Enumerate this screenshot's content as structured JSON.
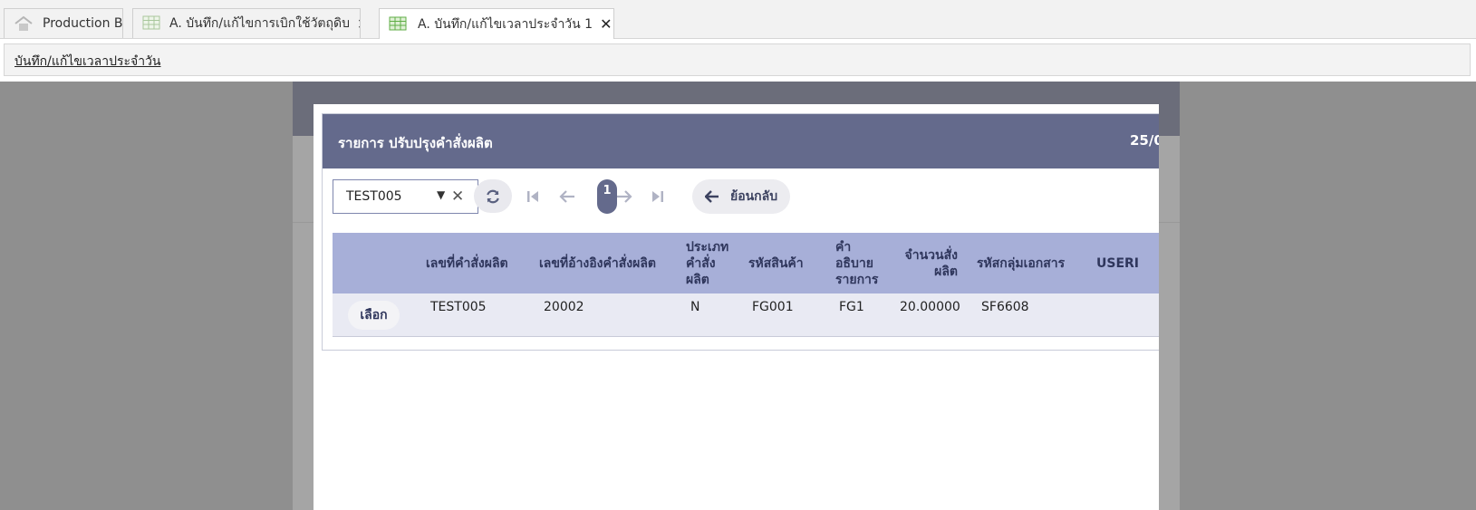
{
  "tabs": [
    {
      "label": "Production BI",
      "icon": "home-icon",
      "closable": false
    },
    {
      "label": "A. บันทึก/แก้ไขการเบิกใช้วัตถุดิบ",
      "icon": "table-icon",
      "closable": true
    },
    {
      "label": "A. บันทึก/แก้ไขเวลาประจำวัน 1",
      "icon": "table-icon",
      "closable": true,
      "active": true
    }
  ],
  "tab_close_glyph": "✕",
  "breadcrumb": "บันทึก/แก้ไขเวลาประจำวัน",
  "modal": {
    "title": "รายการ ปรับปรุงคำสั่งผลิต",
    "date_partial": "25/0",
    "filter": {
      "value": "TEST005"
    },
    "pagination": {
      "current_page": "1"
    },
    "back_label": "ย้อนกลับ"
  },
  "table": {
    "columns": [
      [
        "เลขที่คำสั่งผลิต"
      ],
      [
        "เลขที่อ้างอิงคำสั่งผลิต"
      ],
      [
        "ประเภท",
        "คำสั่ง",
        "ผลิต"
      ],
      [
        "รหัสสินค้า"
      ],
      [
        "คำ",
        "อธิบาย",
        "รายการ"
      ],
      [
        "จำนวนสั่ง",
        "ผลิต"
      ],
      [
        "รหัสกลุ่มเอกสาร"
      ],
      [
        "USERI"
      ]
    ],
    "rows": [
      {
        "action": "เลือก",
        "cells": [
          "TEST005",
          "20002",
          "N",
          "FG001",
          "FG1",
          "20.00000",
          "SF6608"
        ]
      }
    ]
  },
  "colors": {
    "header_bg": "#646a8c",
    "table_header_bg": "#a7afd8",
    "row_bg": "#e9eaf3",
    "overlay": "#8f8f8f"
  }
}
